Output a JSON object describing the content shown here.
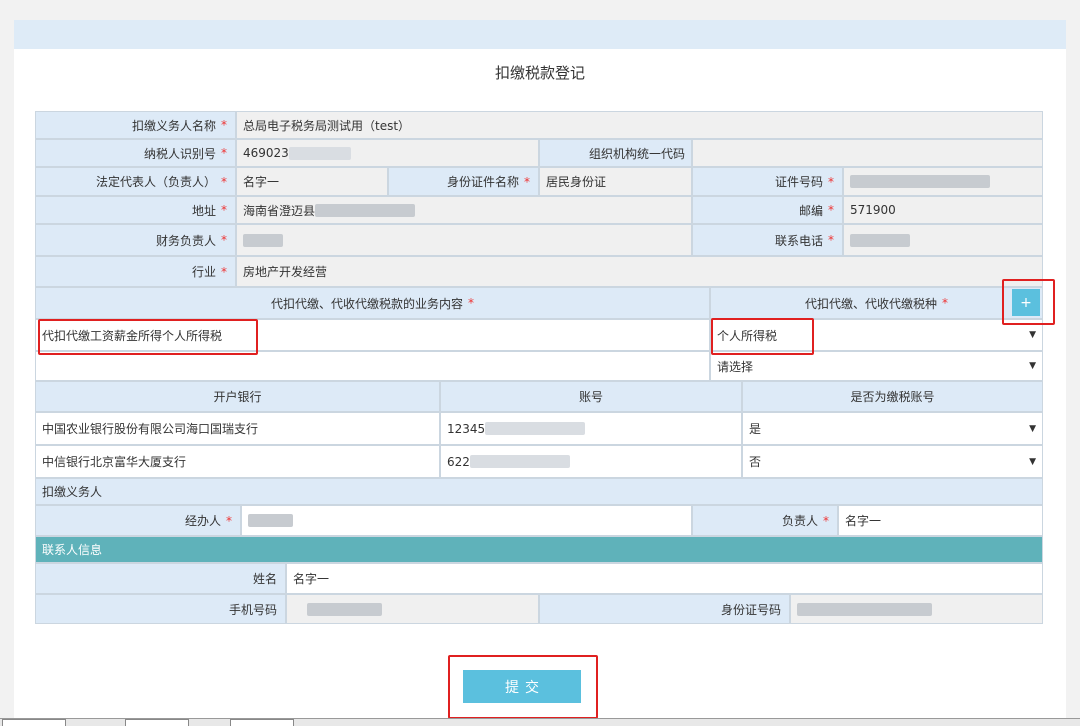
{
  "page": {
    "title": "扣缴税款登记",
    "required_mark": "*"
  },
  "form": {
    "withholder_name": {
      "label": "扣缴义务人名称",
      "value": "总局电子税务局测试用（test）"
    },
    "taxpayer_id": {
      "label": "纳税人识别号",
      "value": "469023"
    },
    "org_code": {
      "label": "组织机构统一代码",
      "value": ""
    },
    "legal_rep": {
      "label": "法定代表人（负责人）",
      "value": "名字一"
    },
    "id_type": {
      "label": "身份证件名称",
      "value": "居民身份证"
    },
    "id_number": {
      "label": "证件号码",
      "value": ""
    },
    "address": {
      "label": "地址",
      "value": "海南省澄迈县"
    },
    "postcode": {
      "label": "邮编",
      "value": "571900"
    },
    "finance_head": {
      "label": "财务负责人",
      "value": ""
    },
    "phone": {
      "label": "联系电话",
      "value": ""
    },
    "industry": {
      "label": "行业",
      "value": "房地产开发经营"
    }
  },
  "business": {
    "content_header": "代扣代缴、代收代缴税款的业务内容",
    "tax_type_header": "代扣代缴、代收代缴税种",
    "add_button": "+",
    "row1": {
      "content": "代扣代缴工资薪金所得个人所得税",
      "tax_type": "个人所得税"
    },
    "row2": {
      "content": "",
      "tax_type": "请选择"
    }
  },
  "bank": {
    "headers": [
      "开户银行",
      "账号",
      "是否为缴税账号"
    ],
    "rows": [
      {
        "bank": "中国农业银行股份有限公司海口国瑞支行",
        "account": "12345",
        "is_tax": "是"
      },
      {
        "bank": "中信银行北京富华大厦支行",
        "account": "622",
        "is_tax": "否"
      }
    ]
  },
  "agent": {
    "section": "扣缴义务人",
    "handler_label": "经办人",
    "handler_value": "",
    "head_label": "负责人",
    "head_value": "名字一"
  },
  "contact": {
    "section": "联系人信息",
    "name_label": "姓名",
    "name_value": "名字一",
    "mobile_label": "手机号码",
    "mobile_value": "",
    "idno_label": "身份证号码",
    "idno_value": ""
  },
  "submit_label": "提交",
  "icons": {
    "dropdown": "caret-down-icon",
    "add": "plus-icon"
  },
  "colors": {
    "accent": "#5bc0de",
    "label_bg": "#ddeaf7",
    "section_teal": "#5fb2ba",
    "highlight": "#e02020"
  }
}
